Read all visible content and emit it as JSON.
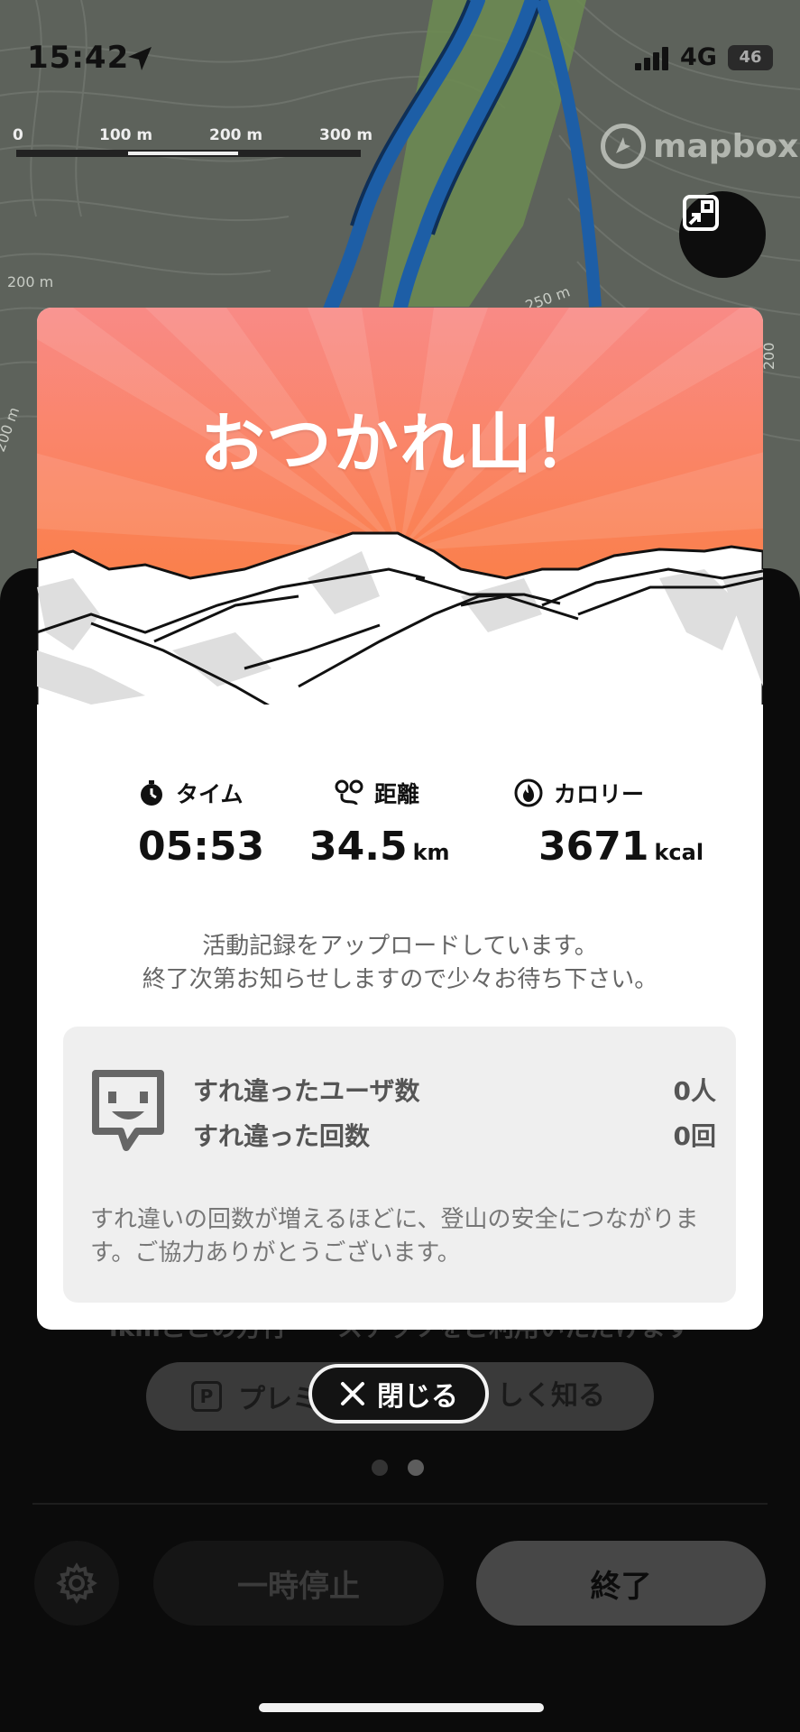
{
  "status_bar": {
    "time": "15:42",
    "network": "4G",
    "battery_label": "46"
  },
  "map": {
    "scale_labels": [
      "0",
      "100 m",
      "200 m",
      "300 m"
    ],
    "attribution": "mapbox",
    "contour_labels": [
      "250 m",
      "200 m",
      "200 m",
      "200"
    ]
  },
  "modal": {
    "title": "おつかれ山！",
    "stats": [
      {
        "icon": "stopwatch-icon",
        "label": "タイム",
        "value": "05:53",
        "unit": ""
      },
      {
        "icon": "route-pin-icon",
        "label": "距離",
        "value": "34.5",
        "unit": "km"
      },
      {
        "icon": "flame-icon",
        "label": "カロリー",
        "value": "3671",
        "unit": "kcal"
      }
    ],
    "upload_line1": "活動記録をアップロードしています。",
    "upload_line2": "終了次第お知らせしますので少々お待ち下さい。",
    "pass": {
      "users_label": "すれ違ったユーザ数",
      "users_value": "0人",
      "count_label": "すれ違った回数",
      "count_value": "0回",
      "note": "すれ違いの回数が増えるほどに、登山の安全につながります。ご協力ありがとうございます。"
    }
  },
  "sheet": {
    "partial_text": "ikiiiここの方行・・ステッソをご利用いただけます",
    "premium_left": "プレミ",
    "premium_icon": "P",
    "premium_right": "しく知る",
    "pause_label": "一時停止",
    "end_label": "終了"
  },
  "close_button": {
    "label": "閉じる"
  },
  "colors": {
    "hero_top": "#f98a86",
    "hero_bottom": "#fb7a2c",
    "route_blue": "#1b5fa8",
    "map_bg": "#5a5f59"
  }
}
